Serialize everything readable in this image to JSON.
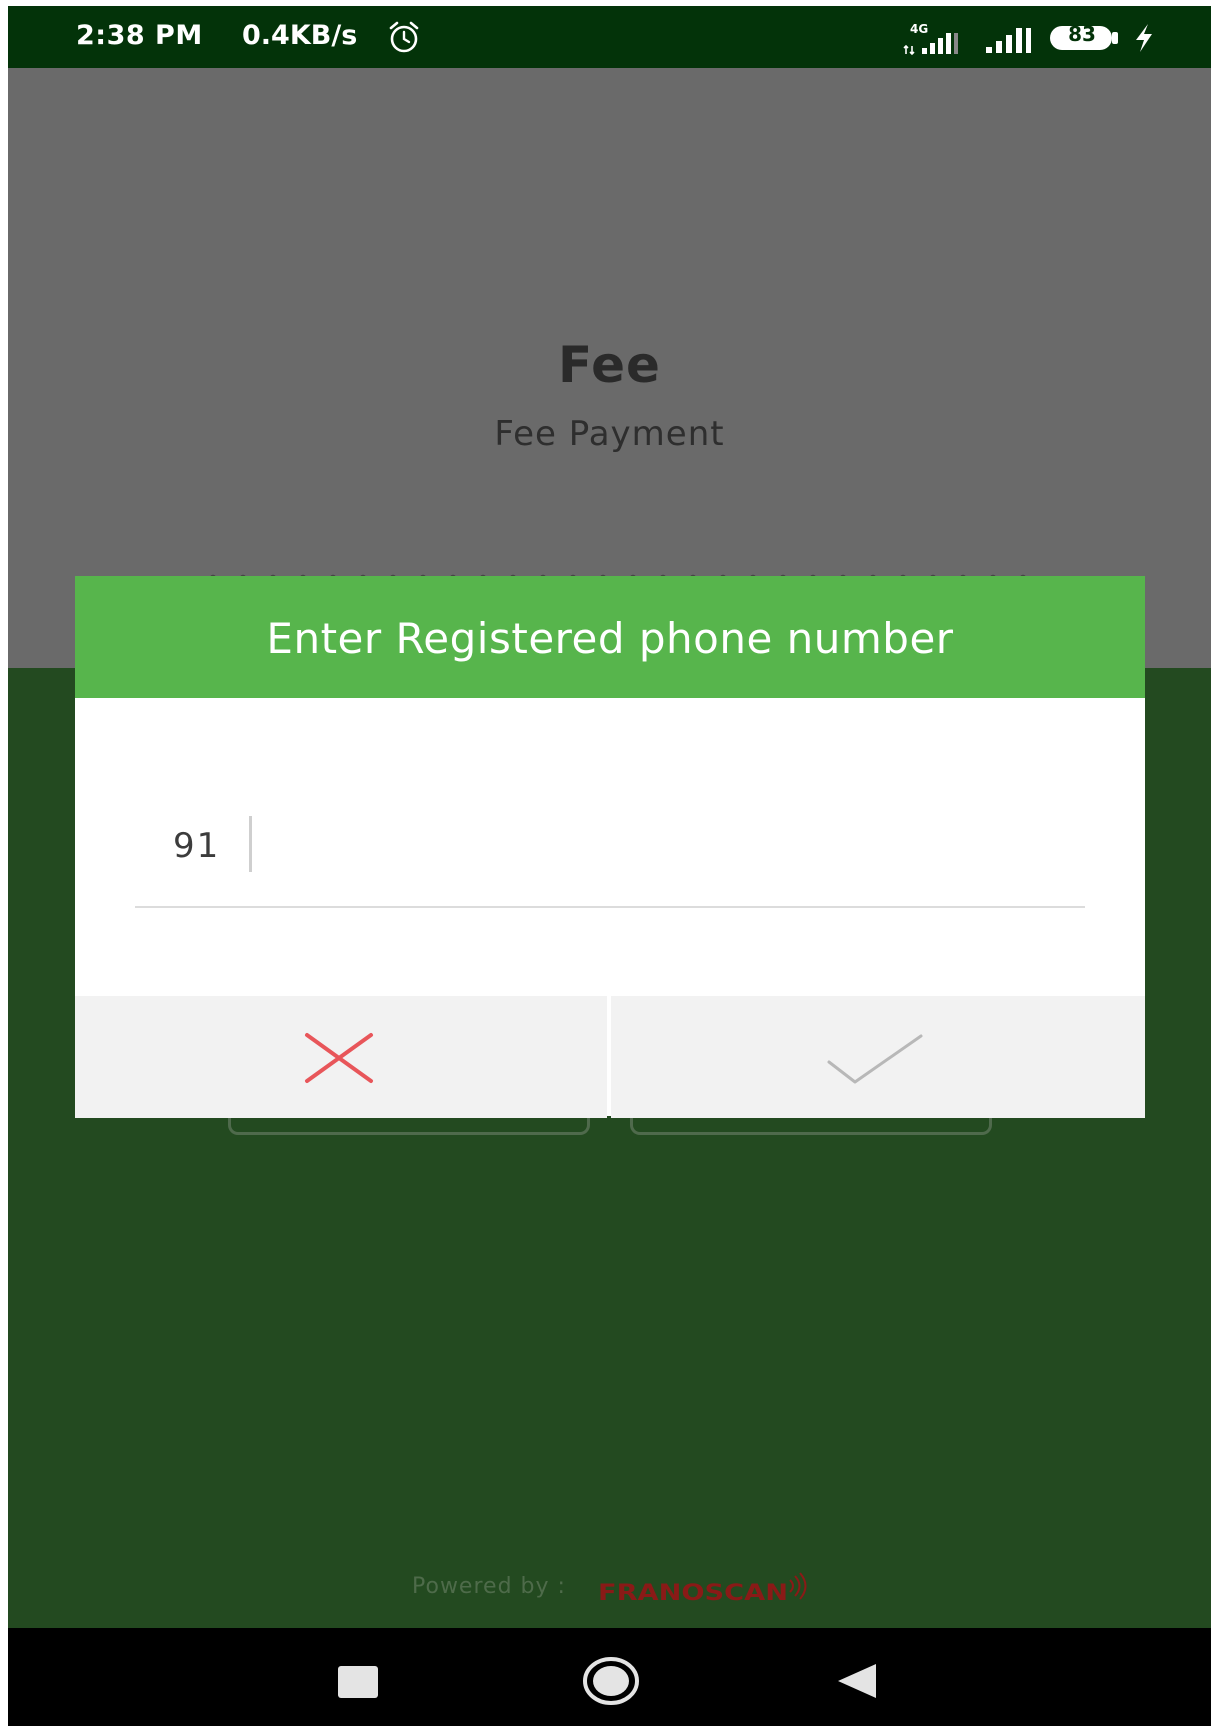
{
  "status_bar": {
    "time": "2:38 PM",
    "speed": "0.4KB/s",
    "network_label": "4G",
    "battery": "83",
    "alarm_icon": "alarm-clock-icon",
    "charging_icon": "lightning-bolt-icon"
  },
  "page": {
    "title": "Fee",
    "subtitle": "Fee Payment"
  },
  "dialog": {
    "title": "Enter Registered phone number",
    "country_code": "91",
    "phone_value": "",
    "phone_placeholder": "",
    "cancel_icon": "close-x-icon",
    "confirm_icon": "checkmark-icon"
  },
  "footer": {
    "powered_by": "Powered by :",
    "brand": "FRANOSCAN"
  },
  "nav_bar": {
    "recents_icon": "square-icon",
    "home_icon": "circle-icon",
    "back_icon": "triangle-back-icon"
  },
  "colors": {
    "status_bar": "#033309",
    "dialog_header": "#57b54c",
    "body_background": "#234a20",
    "header_background": "#6a6a6a",
    "cancel_x": "#e8565a",
    "confirm_check": "#b8b8b8",
    "brand": "#b8201c"
  }
}
